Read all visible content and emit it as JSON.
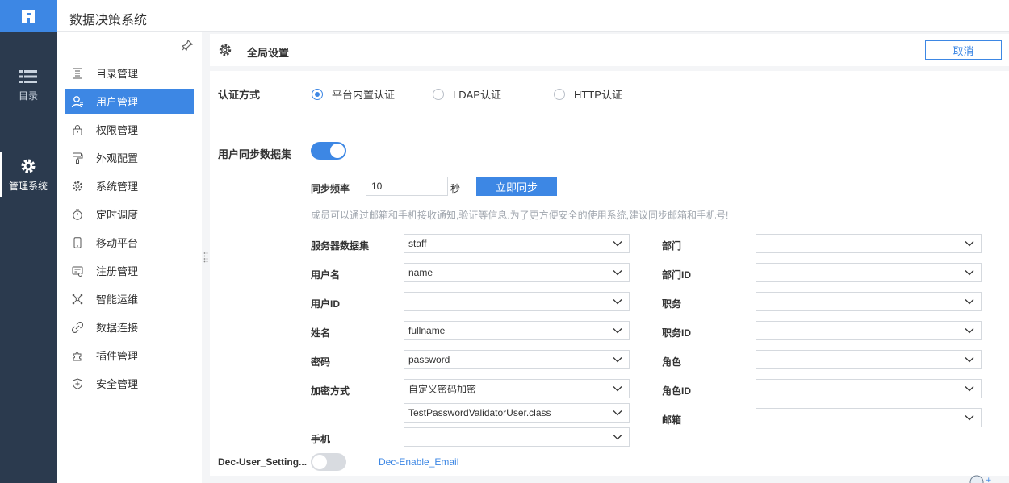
{
  "app": {
    "title": "数据决策系统"
  },
  "rail": {
    "items": [
      {
        "label": "目录",
        "icon": "list-icon"
      },
      {
        "label": "管理系统",
        "icon": "gear-icon"
      }
    ]
  },
  "sidebar": {
    "items": [
      {
        "label": "目录管理",
        "icon": "catalog-icon"
      },
      {
        "label": "用户管理",
        "icon": "user-icon"
      },
      {
        "label": "权限管理",
        "icon": "lock-icon"
      },
      {
        "label": "外观配置",
        "icon": "paint-roller-icon"
      },
      {
        "label": "系统管理",
        "icon": "settings-icon"
      },
      {
        "label": "定时调度",
        "icon": "timer-icon"
      },
      {
        "label": "移动平台",
        "icon": "mobile-icon"
      },
      {
        "label": "注册管理",
        "icon": "register-icon"
      },
      {
        "label": "智能运维",
        "icon": "network-icon"
      },
      {
        "label": "数据连接",
        "icon": "link-icon"
      },
      {
        "label": "插件管理",
        "icon": "puzzle-icon"
      },
      {
        "label": "安全管理",
        "icon": "shield-icon"
      }
    ],
    "active_index": 1
  },
  "header": {
    "title": "全局设置",
    "cancel_label": "取消"
  },
  "auth": {
    "label": "认证方式",
    "options": [
      "平台内置认证",
      "LDAP认证",
      "HTTP认证"
    ],
    "selected": "平台内置认证"
  },
  "sync": {
    "label": "用户同步数据集",
    "enabled": true,
    "freq_label": "同步频率",
    "freq_value": "10",
    "freq_unit": "秒",
    "sync_now_label": "立即同步",
    "hint": "成员可以通过邮箱和手机接收通知,验证等信息.为了更方便安全的使用系统,建议同步邮箱和手机号!"
  },
  "fields_left": [
    {
      "label": "服务器数据集",
      "value": "staff"
    },
    {
      "label": "用户名",
      "value": "name"
    },
    {
      "label": "用户ID",
      "value": ""
    },
    {
      "label": "姓名",
      "value": "fullname"
    },
    {
      "label": "密码",
      "value": "password"
    },
    {
      "label": "加密方式",
      "value": "自定义密码加密",
      "extra": "TestPasswordValidatorUser.class"
    },
    {
      "label": "手机",
      "value": ""
    }
  ],
  "fields_right": [
    {
      "label": "部门",
      "value": ""
    },
    {
      "label": "部门ID",
      "value": ""
    },
    {
      "label": "职务",
      "value": ""
    },
    {
      "label": "职务ID",
      "value": ""
    },
    {
      "label": "角色",
      "value": ""
    },
    {
      "label": "角色ID",
      "value": ""
    },
    {
      "label": "邮箱",
      "value": ""
    }
  ],
  "bottom": {
    "setting_label": "Dec-User_Setting...",
    "toggle_on": false,
    "link_label": "Dec-Enable_Email"
  },
  "colors": {
    "accent": "#3d87e4",
    "rail": "#2b3a4e"
  }
}
